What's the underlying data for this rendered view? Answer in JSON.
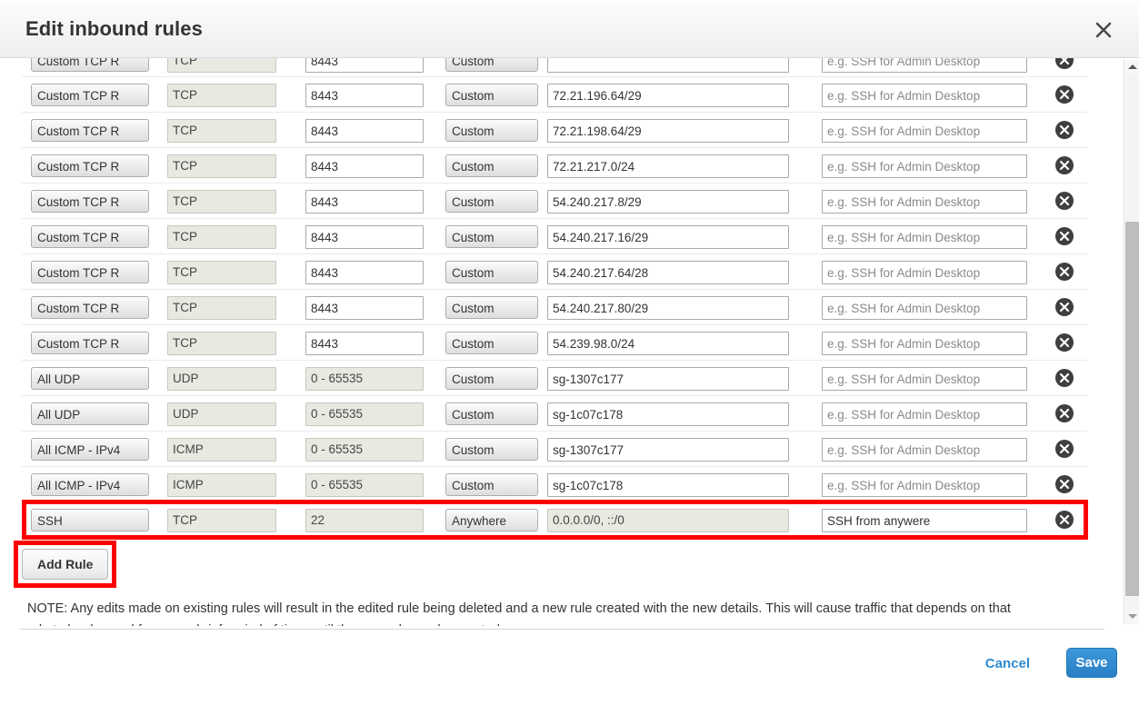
{
  "header": {
    "title": "Edit inbound rules",
    "close_icon": "close-icon"
  },
  "table": {
    "description_placeholder": "e.g. SSH for Admin Desktop",
    "delete_icon": "delete-circle-icon",
    "partial_top_row": {
      "type": "Custom TCP R",
      "protocol": "TCP",
      "port": "8443",
      "source": "Custom",
      "cidr": "",
      "description": ""
    },
    "rows": [
      {
        "type": "Custom TCP R",
        "protocol": "TCP",
        "port": "8443",
        "source": "Custom",
        "cidr": "72.21.196.64/29",
        "description": ""
      },
      {
        "type": "Custom TCP R",
        "protocol": "TCP",
        "port": "8443",
        "source": "Custom",
        "cidr": "72.21.198.64/29",
        "description": ""
      },
      {
        "type": "Custom TCP R",
        "protocol": "TCP",
        "port": "8443",
        "source": "Custom",
        "cidr": "72.21.217.0/24",
        "description": ""
      },
      {
        "type": "Custom TCP R",
        "protocol": "TCP",
        "port": "8443",
        "source": "Custom",
        "cidr": "54.240.217.8/29",
        "description": ""
      },
      {
        "type": "Custom TCP R",
        "protocol": "TCP",
        "port": "8443",
        "source": "Custom",
        "cidr": "54.240.217.16/29",
        "description": ""
      },
      {
        "type": "Custom TCP R",
        "protocol": "TCP",
        "port": "8443",
        "source": "Custom",
        "cidr": "54.240.217.64/28",
        "description": ""
      },
      {
        "type": "Custom TCP R",
        "protocol": "TCP",
        "port": "8443",
        "source": "Custom",
        "cidr": "54.240.217.80/29",
        "description": ""
      },
      {
        "type": "Custom TCP R",
        "protocol": "TCP",
        "port": "8443",
        "source": "Custom",
        "cidr": "54.239.98.0/24",
        "description": ""
      },
      {
        "type": "All UDP",
        "protocol": "UDP",
        "port": "0 - 65535",
        "source": "Custom",
        "cidr": "sg-1307c177",
        "description": ""
      },
      {
        "type": "All UDP",
        "protocol": "UDP",
        "port": "0 - 65535",
        "source": "Custom",
        "cidr": "sg-1c07c178",
        "description": ""
      },
      {
        "type": "All ICMP - IPv4",
        "protocol": "ICMP",
        "port": "0 - 65535",
        "source": "Custom",
        "cidr": "sg-1307c177",
        "description": ""
      },
      {
        "type": "All ICMP - IPv4",
        "protocol": "ICMP",
        "port": "0 - 65535",
        "source": "Custom",
        "cidr": "sg-1c07c178",
        "description": ""
      }
    ],
    "highlighted_row": {
      "type": "SSH",
      "protocol": "TCP",
      "port": "22",
      "source": "Anywhere",
      "cidr": "0.0.0.0/0, ::/0",
      "description": "SSH from anywere"
    }
  },
  "actions": {
    "add_rule_label": "Add Rule",
    "note": "NOTE: Any edits made on existing rules will result in the edited rule being deleted and a new rule created with the new details. This will cause traffic that depends on that rule to be dropped for a very brief period of time until the new rule can be created.",
    "cancel_label": "Cancel",
    "save_label": "Save"
  },
  "colors": {
    "highlight": "#ff0000",
    "primary": "#2a7fc4",
    "link": "#2e8bd0",
    "disabled_field": "#e9e9e2"
  },
  "scrollbar": {
    "up_icon": "chevron-up-icon",
    "down_icon": "chevron-down-icon"
  }
}
